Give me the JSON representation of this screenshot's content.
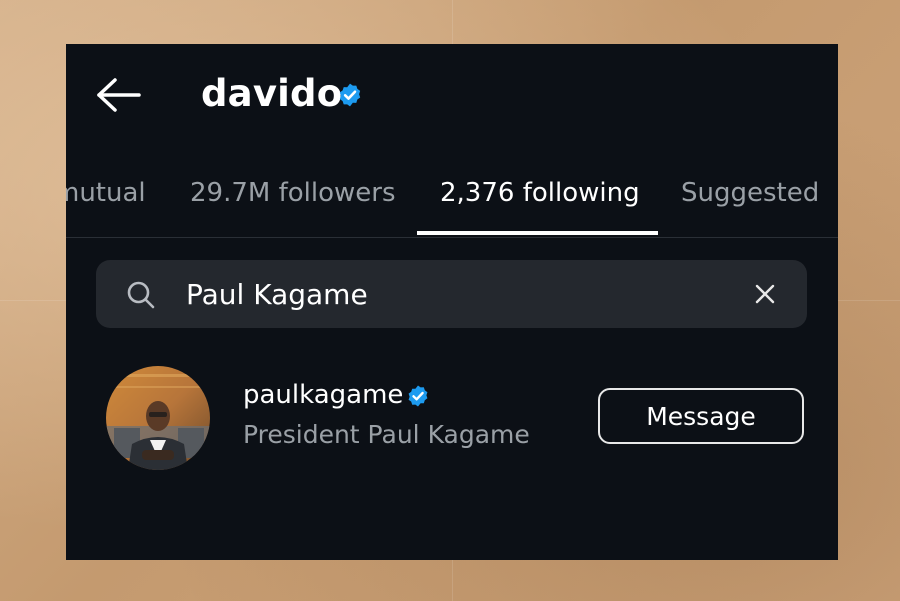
{
  "header": {
    "title": "davido",
    "back_icon": "back-arrow-icon",
    "verified_icon": "verified-badge-icon"
  },
  "tabs": [
    {
      "label": "mutual",
      "active": false
    },
    {
      "label": "29.7M followers",
      "active": false
    },
    {
      "label": "2,376 following",
      "active": true
    },
    {
      "label": "Suggested",
      "active": false
    }
  ],
  "search": {
    "value": "Paul Kagame",
    "search_icon": "search-icon",
    "clear_icon": "close-icon"
  },
  "result": {
    "username": "paulkagame",
    "full_name": "President Paul Kagame",
    "verified": true,
    "message_label": "Message"
  },
  "colors": {
    "screen_background": "#0c1016",
    "search_background": "#24282e",
    "verified_blue": "#1d9bf0",
    "muted_text": "#9aa0a6",
    "paper_background": "#c9a27a"
  }
}
